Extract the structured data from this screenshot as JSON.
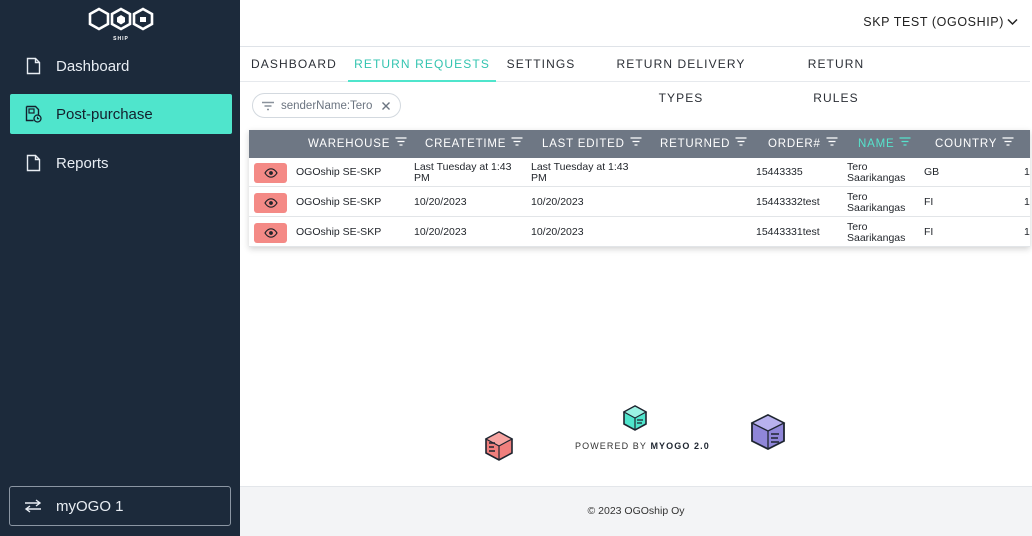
{
  "sidebar": {
    "logo_text": "OGO",
    "logo_sub": "SHIP",
    "items": [
      {
        "label": "Dashboard",
        "icon": "document-icon"
      },
      {
        "label": "Post-purchase",
        "icon": "return-box-icon",
        "active": true
      },
      {
        "label": "Reports",
        "icon": "document-icon"
      }
    ],
    "switcher": {
      "label": "myOGO 1",
      "icon": "switch-arrows-icon"
    }
  },
  "header": {
    "account": "SKP TEST (OGOSHIP)"
  },
  "tabs": [
    {
      "label": "DASHBOARD"
    },
    {
      "label": "RETURN REQUESTS",
      "active": true
    },
    {
      "label": "SETTINGS"
    },
    {
      "label": "RETURN DELIVERY TYPES"
    },
    {
      "label": "RETURN RULES"
    }
  ],
  "filter": {
    "chip": "senderName:Tero"
  },
  "table": {
    "columns": [
      "WAREHOUSE",
      "CREATETIME",
      "LAST EDITED",
      "RETURNED",
      "ORDER#",
      "NAME",
      "COUNTRY"
    ],
    "sorted_column": "NAME",
    "rows": [
      {
        "warehouse": "OGOship SE-SKP",
        "createtime": "Last Tuesday at 1:43 PM",
        "last_edited": "Last Tuesday at 1:43 PM",
        "returned": "",
        "order": "15443335",
        "name": "Tero Saarikangas",
        "country": "GB",
        "extra": "1"
      },
      {
        "warehouse": "OGOship SE-SKP",
        "createtime": "10/20/2023",
        "last_edited": "10/20/2023",
        "returned": "",
        "order": "15443332test",
        "name": "Tero Saarikangas",
        "country": "FI",
        "extra": "1"
      },
      {
        "warehouse": "OGOship SE-SKP",
        "createtime": "10/20/2023",
        "last_edited": "10/20/2023",
        "returned": "",
        "order": "15443331test",
        "name": "Tero Saarikangas",
        "country": "FI",
        "extra": "1"
      }
    ]
  },
  "branding": {
    "powered_prefix": "POWERED BY ",
    "powered_brand": "MYOGO 2.0"
  },
  "footer": {
    "copyright": "© 2023 OGOship Oy"
  },
  "colors": {
    "sidebar": "#1c2a3b",
    "accent": "#4fe5cc",
    "view_button": "#f48a86",
    "table_header": "#6e7784"
  }
}
